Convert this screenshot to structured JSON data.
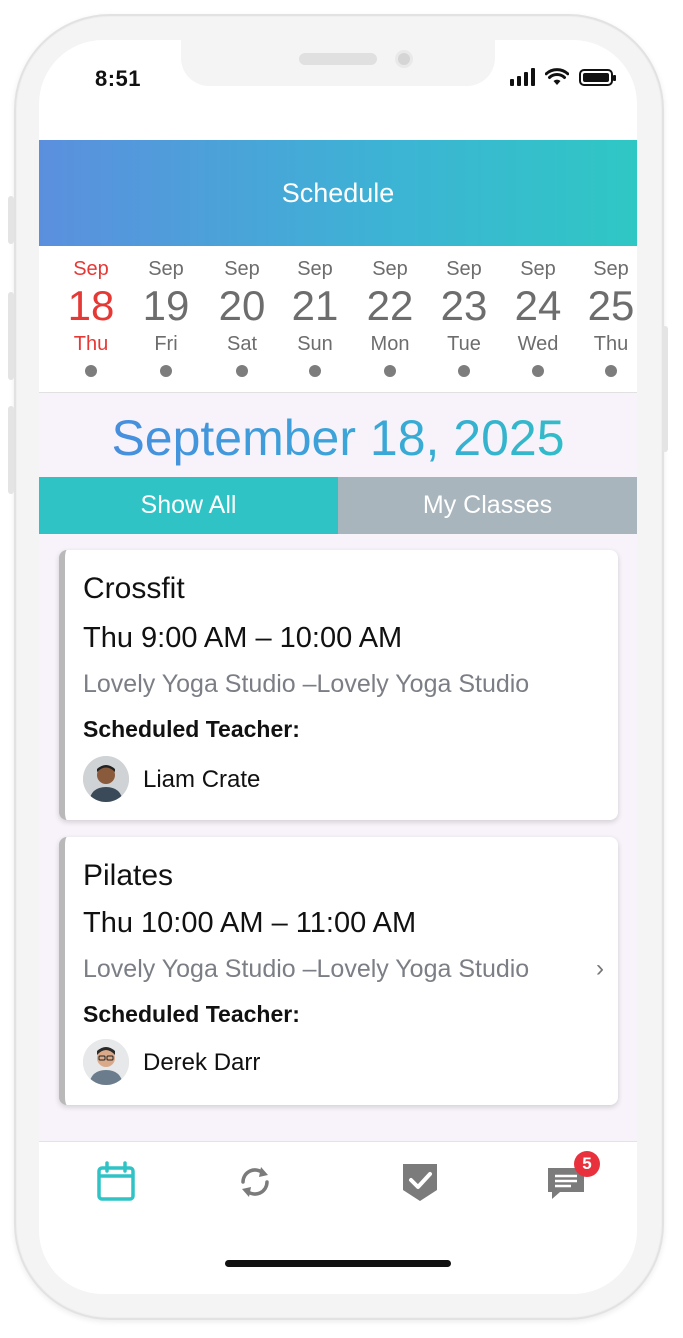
{
  "status": {
    "time": "8:51"
  },
  "header": {
    "title": "Schedule"
  },
  "days": [
    {
      "month": "Sep",
      "day": "18",
      "weekday": "Thu",
      "active": true
    },
    {
      "month": "Sep",
      "day": "19",
      "weekday": "Fri",
      "active": false
    },
    {
      "month": "Sep",
      "day": "20",
      "weekday": "Sat",
      "active": false
    },
    {
      "month": "Sep",
      "day": "21",
      "weekday": "Sun",
      "active": false
    },
    {
      "month": "Sep",
      "day": "22",
      "weekday": "Mon",
      "active": false
    },
    {
      "month": "Sep",
      "day": "23",
      "weekday": "Tue",
      "active": false
    },
    {
      "month": "Sep",
      "day": "24",
      "weekday": "Wed",
      "active": false
    },
    {
      "month": "Sep",
      "day": "25",
      "weekday": "Thu",
      "active": false
    }
  ],
  "selected_date": "September 18, 2025",
  "filters": {
    "show_all": "Show All",
    "my_classes": "My Classes",
    "active": "show_all"
  },
  "classes": [
    {
      "name": "Crossfit",
      "time": "Thu 9:00 AM – 10:00 AM",
      "location": "Lovely Yoga Studio –Lovely Yoga Studio",
      "teacher_label": "Scheduled Teacher:",
      "teacher": "Liam Crate"
    },
    {
      "name": "Pilates",
      "time": "Thu 10:00 AM – 11:00 AM",
      "location": "Lovely Yoga Studio –Lovely Yoga Studio",
      "teacher_label": "Scheduled Teacher:",
      "teacher": "Derek Darr"
    }
  ],
  "tabbar": {
    "items": [
      "calendar-icon",
      "refresh-icon",
      "check-shield-icon",
      "messages-icon"
    ],
    "badge": "5"
  },
  "colors": {
    "accent": "#2fc3c5",
    "header_start": "#5b8fde",
    "header_end": "#2fc7c4",
    "active_day": "#e53935",
    "inactive_tab": "#a8b5bd",
    "badge": "#e8313d"
  }
}
